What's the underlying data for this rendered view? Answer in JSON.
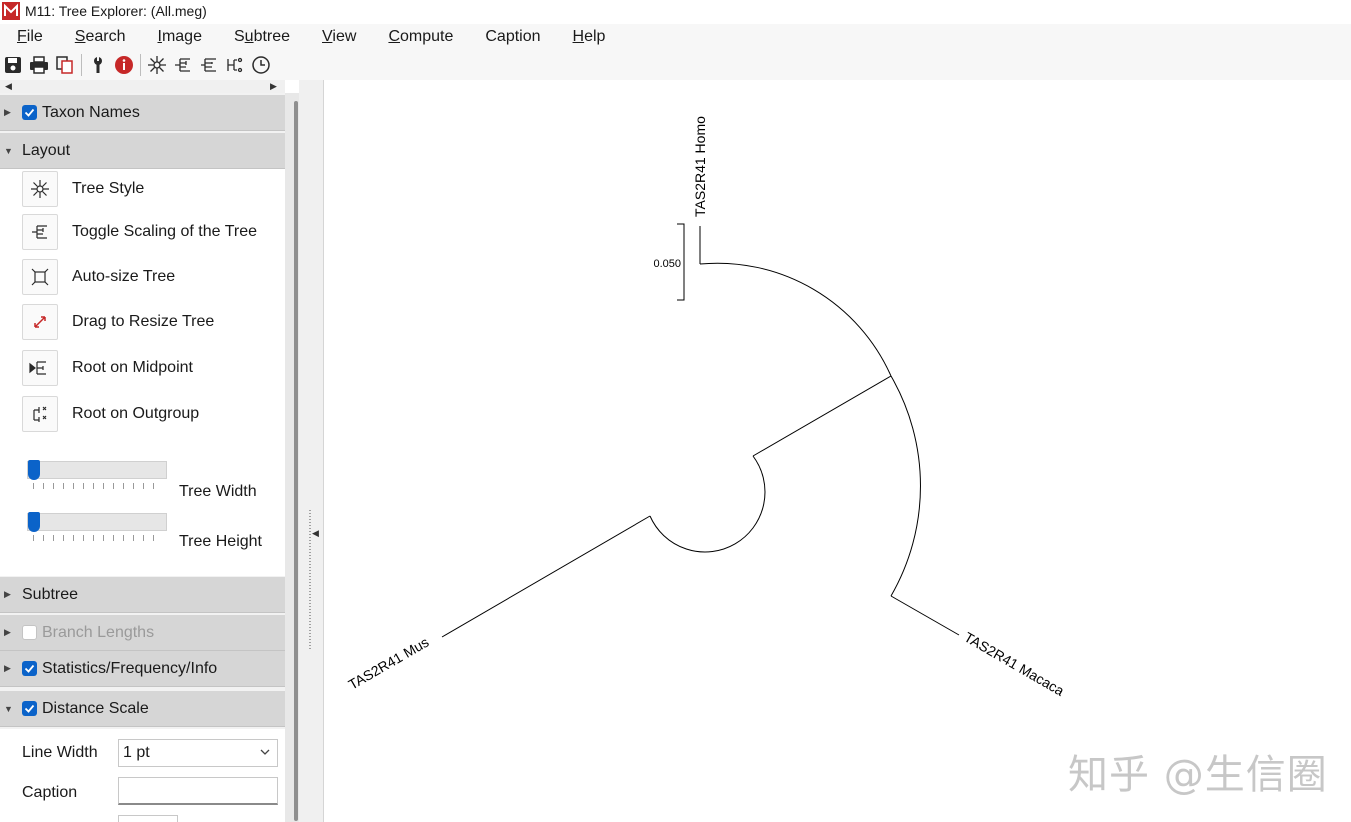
{
  "window": {
    "title": "M11: Tree Explorer: (All.meg)",
    "logo_text": "M"
  },
  "menu": [
    {
      "label": "File",
      "underline": "F",
      "rest": "ile"
    },
    {
      "label": "Search",
      "underline": "S",
      "rest": "earch"
    },
    {
      "label": "Image",
      "underline": "I",
      "rest": "mage"
    },
    {
      "label": "Subtree",
      "pre": "S",
      "underline": "u",
      "rest": "btree"
    },
    {
      "label": "View",
      "underline": "V",
      "rest": "iew"
    },
    {
      "label": "Compute",
      "underline": "C",
      "rest": "ompute"
    },
    {
      "label": "Caption",
      "underline": "",
      "rest": "Caption"
    },
    {
      "label": "Help",
      "underline": "H",
      "rest": "elp"
    }
  ],
  "toolbar": {
    "buttons": [
      "save-icon",
      "print-icon",
      "copy-icon",
      "wrench-icon",
      "info-icon",
      "tree-style-icon",
      "toggle-scaling-icon",
      "auto-size-icon",
      "root-midpoint-icon",
      "clock-icon"
    ]
  },
  "sidebar": {
    "taxon_names": {
      "label": "Taxon Names",
      "checked": true
    },
    "layout": {
      "label": "Layout",
      "items": [
        {
          "label": "Tree Style",
          "icon": "tree-style-icon"
        },
        {
          "label": "Toggle Scaling of the Tree",
          "icon": "toggle-scaling-icon"
        },
        {
          "label": "Auto-size Tree",
          "icon": "auto-size-icon"
        },
        {
          "label": "Drag to Resize Tree",
          "icon": "resize-arrow-icon"
        },
        {
          "label": "Root on Midpoint",
          "icon": "root-midpoint-icon"
        },
        {
          "label": "Root on Outgroup",
          "icon": "root-outgroup-icon"
        }
      ],
      "tree_width_label": "Tree Width",
      "tree_height_label": "Tree Height",
      "tree_width_value": 0,
      "tree_height_value": 0
    },
    "subtree": {
      "label": "Subtree"
    },
    "branch_lengths": {
      "label": "Branch Lengths",
      "checked": false,
      "enabled": false
    },
    "statistics": {
      "label": "Statistics/Frequency/Info",
      "checked": true
    },
    "distance_scale": {
      "label": "Distance Scale",
      "checked": true,
      "line_width_label": "Line Width",
      "line_width_value": "1 pt",
      "caption_label": "Caption",
      "caption_value": ""
    }
  },
  "tree": {
    "scale_label": "0.050",
    "taxa": [
      {
        "name": "TAS2R41 Homo"
      },
      {
        "name": "TAS2R41 Mus"
      },
      {
        "name": "TAS2R41 Macaca"
      }
    ]
  },
  "watermark": "知乎 @生信圈",
  "colors": {
    "accent": "#0b63c9",
    "header_bg": "#d6d6d6",
    "info_red": "#c62828"
  }
}
